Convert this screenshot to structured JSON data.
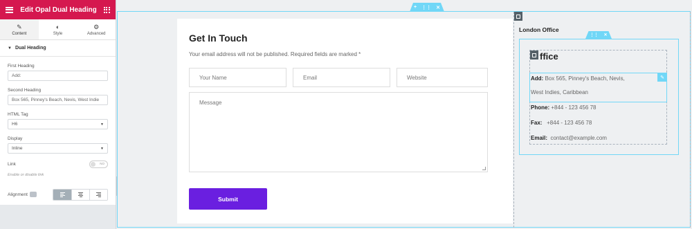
{
  "sidebar": {
    "header_title": "Edit Opal Dual Heading",
    "tabs": [
      {
        "label": "Content",
        "icon": "pencil-icon"
      },
      {
        "label": "Style",
        "icon": "half-circle-icon"
      },
      {
        "label": "Advanced",
        "icon": "gear-icon"
      }
    ],
    "section_title": "Dual Heading",
    "first_heading_label": "First Heading",
    "first_heading_value": "Add:",
    "second_heading_label": "Second Heading",
    "second_heading_value": "Box 565, Pinney's Beach, Nevis,  West Indie",
    "html_tag_label": "HTML Tag",
    "html_tag_value": "H6",
    "display_label": "Display",
    "display_value": "Inline",
    "link_label": "Link",
    "link_toggle_text": "NO",
    "link_hint": "Enable or disable link",
    "alignment_label": "Alignment"
  },
  "form": {
    "title": "Get In Touch",
    "note": "Your email address will not be published. Required fields are marked *",
    "name_placeholder": "Your Name",
    "email_placeholder": "Email",
    "website_placeholder": "Website",
    "message_placeholder": "Message",
    "submit_label": "Submit"
  },
  "office": {
    "title": "London Office",
    "heading_visible": "ffice",
    "address_label": "Add:",
    "address_line1": " Box 565, Pinney's Beach, Nevis,",
    "address_line2": "West Indies, Caribbean",
    "phone_label": "Phone:",
    "phone_value": " +844 - 123 456 78",
    "fax_label": "Fax:",
    "fax_value": "   +844 - 123 456 78",
    "email_label": "Email:",
    "email_value": "  contact@example.com"
  },
  "colors": {
    "header_bg": "#d5184f",
    "submit_bg": "#6a1fe0",
    "selection": "#71d7f7"
  }
}
